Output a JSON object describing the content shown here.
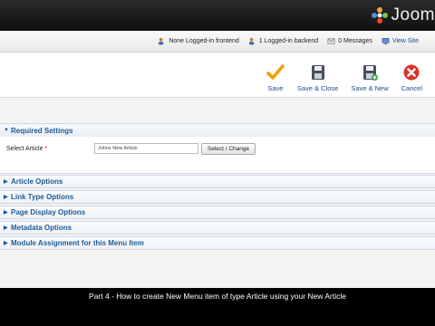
{
  "brand": {
    "logo_text": "Joom"
  },
  "status_bar": {
    "frontend": "None Logged-in frontend",
    "backend": "1 Logged-in backend",
    "messages": "0 Messages",
    "view_site": "View Site"
  },
  "toolbar": {
    "save": "Save",
    "save_close": "Save & Close",
    "save_new": "Save & New",
    "cancel": "Cancel"
  },
  "required_settings": {
    "title": "Required Settings",
    "select_article_label": "Select Article",
    "required_marker": "*",
    "article_value": "Johns New Article",
    "select_button": "Select / Change"
  },
  "option_panels": [
    "Article Options",
    "Link Type Options",
    "Page Display Options",
    "Metadata Options",
    "Module Assignment for this Menu Item"
  ],
  "caption": "Part 4 - How to create New Menu item of type Article using your New Article",
  "colors": {
    "link_blue": "#1d5a96",
    "save_orange": "#f0a000",
    "cancel_red": "#d9342b"
  }
}
